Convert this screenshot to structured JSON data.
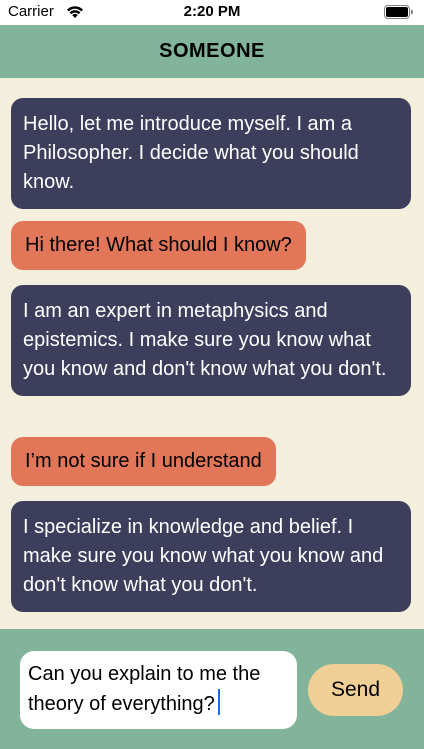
{
  "status_bar": {
    "carrier": "Carrier",
    "time": "2:20 PM",
    "icons": [
      "wifi-icon",
      "battery-icon"
    ]
  },
  "header": {
    "title": "SOMEONE",
    "color": "#82b49c"
  },
  "messages": [
    {
      "sender": "other",
      "text": "Hello, let me introduce myself. I am a Philosopher. I decide what you should know."
    },
    {
      "sender": "me",
      "text": "Hi there! What should I know?"
    },
    {
      "sender": "other",
      "text": "I am an expert in metaphysics and epistemics. I make sure you know what you know and don't know what you don't."
    },
    {
      "sender": "me",
      "text": "I’m not sure if I understand"
    },
    {
      "sender": "other",
      "text": "I specialize in knowledge and belief. I make sure you know what you know and don't know what you don't."
    }
  ],
  "composer": {
    "value": "Can you explain to me the theory of everything?",
    "send_label": "Send"
  },
  "colors": {
    "background": "#f3efdc",
    "incoming_bubble": "#3d3d5c",
    "outgoing_bubble": "#e27658",
    "send_button": "#f0cf96"
  }
}
